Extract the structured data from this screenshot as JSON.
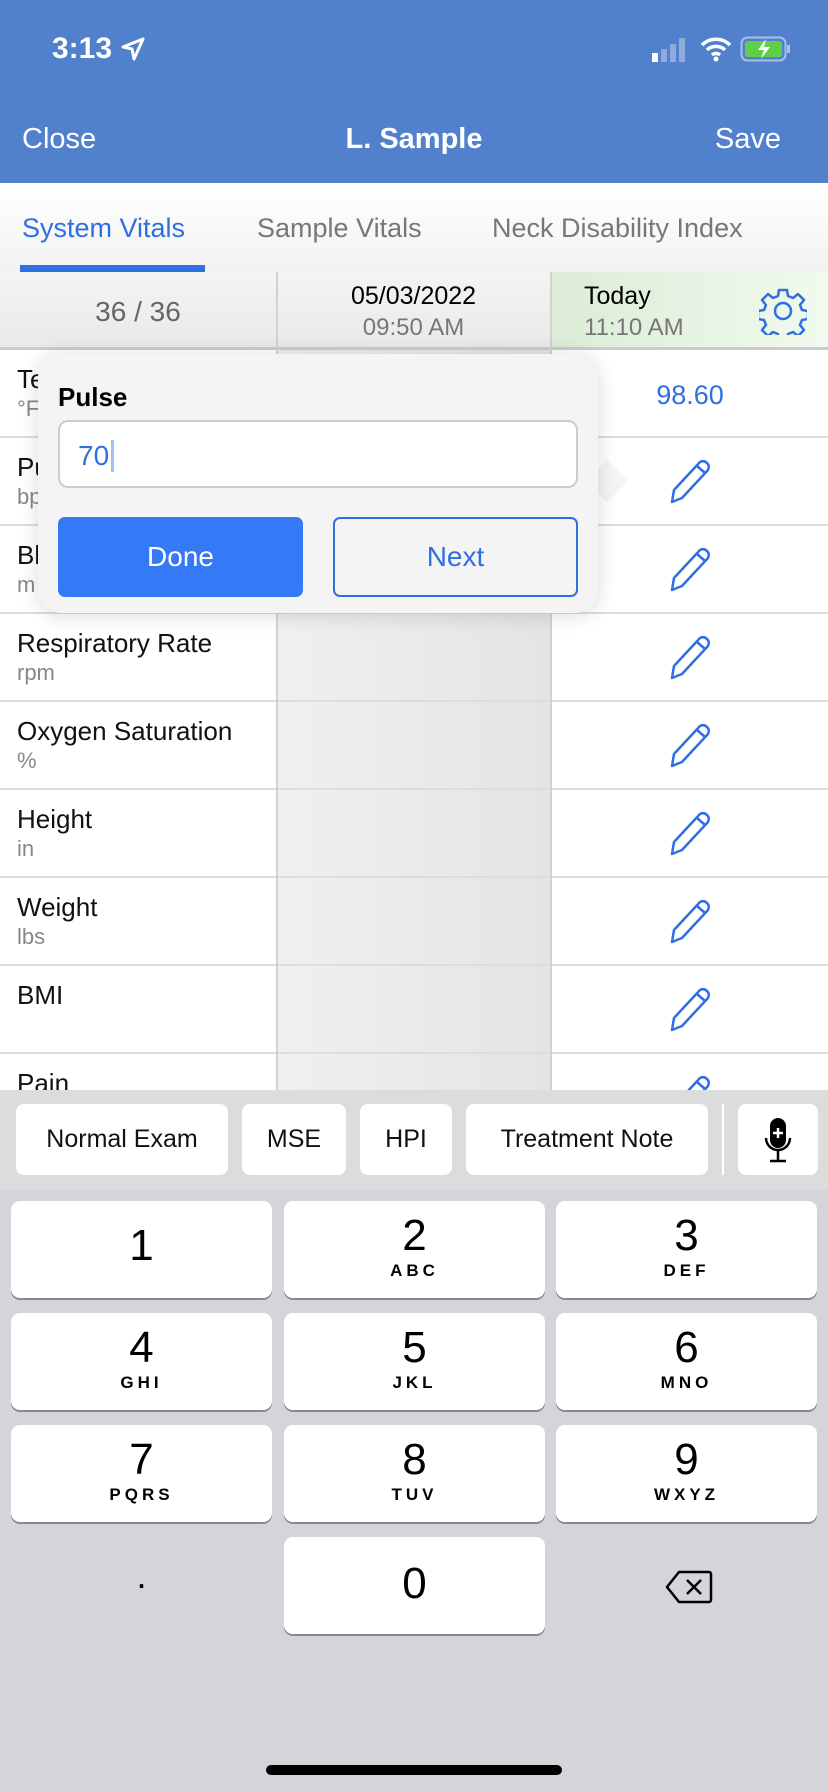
{
  "status_bar": {
    "time": "3:13",
    "icons": [
      "location-arrow-icon",
      "cellular-signal-icon",
      "wifi-icon",
      "battery-charging-icon"
    ]
  },
  "nav": {
    "close": "Close",
    "title": "L. Sample",
    "save": "Save"
  },
  "tabs": [
    {
      "label": "System Vitals",
      "active": true
    },
    {
      "label": "Sample Vitals"
    },
    {
      "label": "Neck Disability Index"
    }
  ],
  "columns": {
    "count": "36 / 36",
    "prev_date": "05/03/2022",
    "prev_time": "09:50 AM",
    "today_label": "Today",
    "today_time": "11:10 AM"
  },
  "rows": [
    {
      "name": "Te",
      "unit": "°F",
      "value": "98.60"
    },
    {
      "name": "Pu",
      "unit": "bp"
    },
    {
      "name": "Bl",
      "unit": "m"
    },
    {
      "name": "Respiratory Rate",
      "unit": "rpm"
    },
    {
      "name": "Oxygen Saturation",
      "unit": "%"
    },
    {
      "name": "Height",
      "unit": "in"
    },
    {
      "name": "Weight",
      "unit": "lbs"
    },
    {
      "name": "BMI",
      "unit": ""
    },
    {
      "name": "Pain",
      "unit": ""
    }
  ],
  "popover": {
    "label": "Pulse",
    "value": "70",
    "done": "Done",
    "next": "Next"
  },
  "accessory": [
    "Normal Exam",
    "MSE",
    "HPI",
    "Treatment Note"
  ],
  "keys": [
    [
      "1",
      ""
    ],
    [
      "2",
      "ABC"
    ],
    [
      "3",
      "DEF"
    ],
    [
      "4",
      "GHI"
    ],
    [
      "5",
      "JKL"
    ],
    [
      "6",
      "MNO"
    ],
    [
      "7",
      "PQRS"
    ],
    [
      "8",
      "TUV"
    ],
    [
      "9",
      "WXYZ"
    ]
  ],
  "key_zero": "0",
  "key_dot": ".",
  "colors": {
    "header": "#5181cd",
    "accent": "#2f6fe0",
    "done": "#3579f6"
  }
}
